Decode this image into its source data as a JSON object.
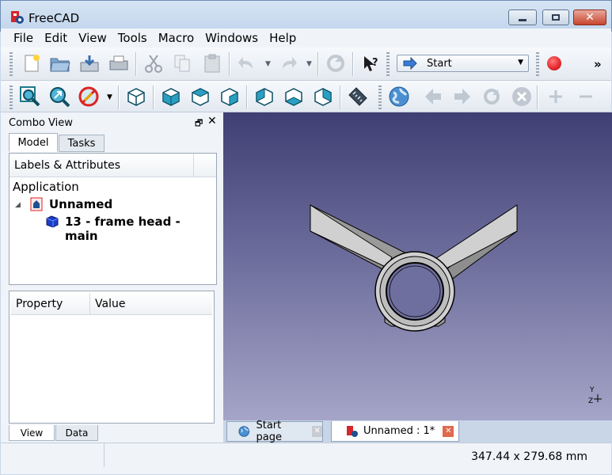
{
  "window": {
    "title": "FreeCAD"
  },
  "menu": [
    "File",
    "Edit",
    "View",
    "Tools",
    "Macro",
    "Windows",
    "Help"
  ],
  "toolbar": {
    "workbench": "Start",
    "whats_this_icon": "whats-this-icon",
    "overflow": "»"
  },
  "combo_view": {
    "title": "Combo View",
    "tabs": [
      "Model",
      "Tasks"
    ],
    "tree_header": "Labels & Attributes",
    "tree": {
      "root": "Application",
      "document": "Unnamed",
      "object": "13 - frame head - main"
    },
    "property_headers": [
      "Property",
      "Value"
    ],
    "bottom_tabs": [
      "View",
      "Data"
    ]
  },
  "doc_tabs": [
    {
      "label": "Start page"
    },
    {
      "label": "Unnamed : 1*"
    }
  ],
  "status": {
    "dimensions": "347.44 x 279.68 mm"
  },
  "axis": {
    "y": "Y",
    "z": "Z"
  },
  "colors": {
    "accent": "#3a7bd5",
    "record": "#e3262c",
    "viewport_top": "#3f3f74",
    "viewport_bottom": "#a5a5c8"
  }
}
